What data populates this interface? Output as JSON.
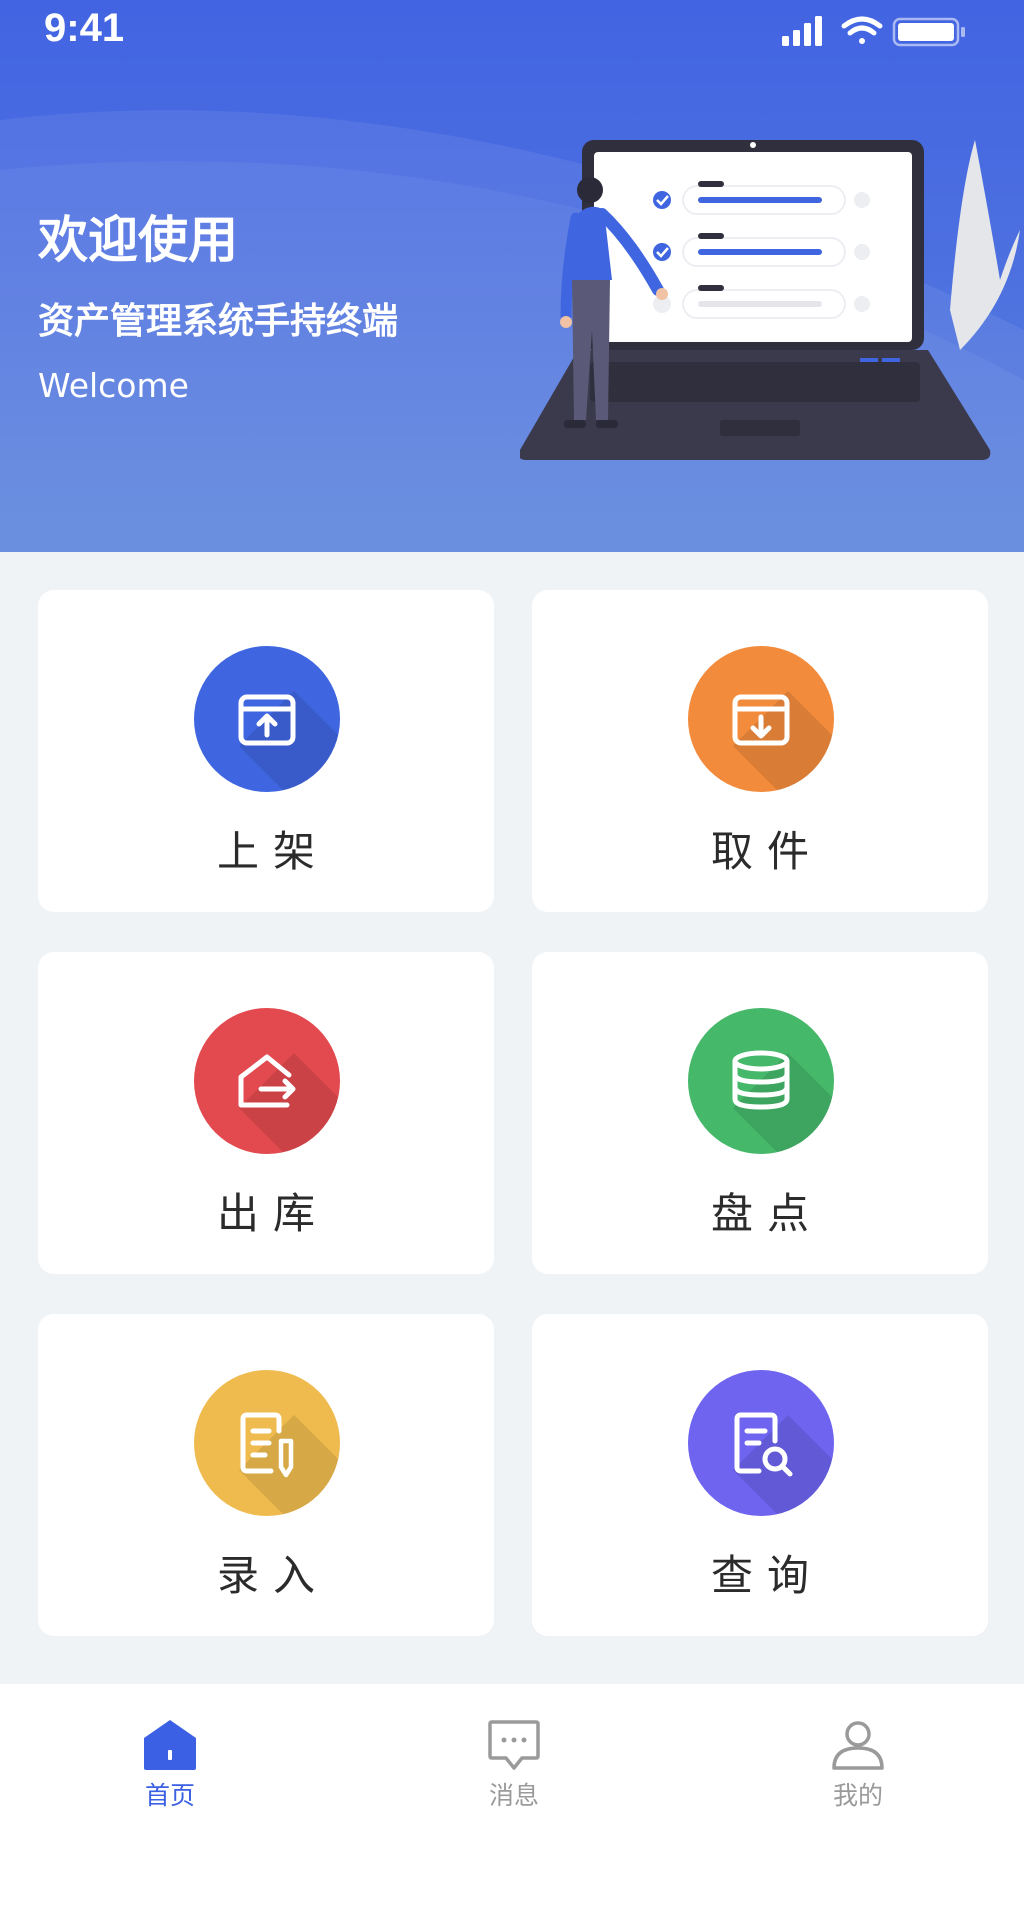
{
  "status_bar": {
    "time": "9:41"
  },
  "header": {
    "title": "欢迎使用",
    "subtitle": "资产管理系统手持终端",
    "welcome": "Welcome"
  },
  "grid": [
    {
      "label": "上架",
      "icon": "shelf-up-icon",
      "color": "#3f66e0"
    },
    {
      "label": "取件",
      "icon": "pickup-icon",
      "color": "#f28b3c"
    },
    {
      "label": "出库",
      "icon": "outbound-icon",
      "color": "#e24a4f"
    },
    {
      "label": "盘点",
      "icon": "inventory-icon",
      "color": "#45b86a"
    },
    {
      "label": "录入",
      "icon": "entry-icon",
      "color": "#efbb4f"
    },
    {
      "label": "查询",
      "icon": "search-doc-icon",
      "color": "#6e64f0"
    }
  ],
  "tabbar": [
    {
      "label": "首页",
      "icon": "home-icon",
      "active": true
    },
    {
      "label": "消息",
      "icon": "message-icon",
      "active": false
    },
    {
      "label": "我的",
      "icon": "profile-icon",
      "active": false
    }
  ],
  "colors": {
    "primary": "#3f66e0",
    "tab_inactive": "#9a9a9a",
    "page_bg": "#f0f3f6"
  }
}
